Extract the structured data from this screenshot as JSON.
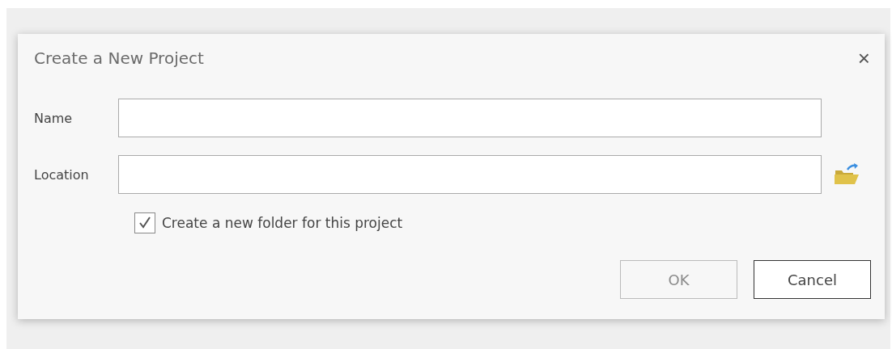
{
  "dialog": {
    "title": "Create a New Project",
    "close": "×"
  },
  "fields": [
    {
      "label": "Name",
      "kind": "text"
    },
    {
      "label": "Location",
      "kind": "folder"
    }
  ],
  "option": {
    "label": "Create a new folder for this project",
    "checked": true
  },
  "buttons": [
    {
      "label": "OK",
      "disabled": true
    },
    {
      "label": "Cancel",
      "disabled": false
    }
  ]
}
